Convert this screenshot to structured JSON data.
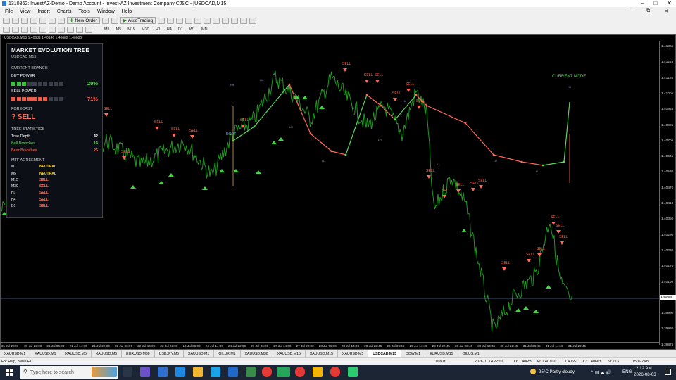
{
  "window": {
    "title": "1310862: InvestAZ-Demo - Demo Account - Invest-AZ Investment Company CJSC - [USDCAD,M15]"
  },
  "menu": [
    "File",
    "View",
    "Insert",
    "Charts",
    "Tools",
    "Window",
    "Help"
  ],
  "toolbar": {
    "new_order": "New Order",
    "auto_trading": "AutoTrading",
    "timeframes": [
      "M1",
      "M5",
      "M15",
      "M30",
      "H1",
      "H4",
      "D1",
      "W1",
      "MN"
    ]
  },
  "chart_header": "USDCAD,M15  1.40681 1.40146 1.40682 1.40686",
  "panel": {
    "title": "MARKET EVOLUTION TREE",
    "subtitle": "USDCAD M15",
    "current_branch": "CURRENT BRANCH",
    "buy_power_label": "BUY POWER",
    "buy_power_pct": "29%",
    "buy_power_value": 0.29,
    "sell_power_label": "SELL POWER",
    "sell_power_pct": "71%",
    "sell_power_value": 0.71,
    "forecast_label": "FORECAST",
    "forecast_value": "? SELL",
    "stats_label": "TREE STATISTICS",
    "tree_depth_label": "Tree Depth",
    "tree_depth": "42",
    "bull_label": "Bull Branches",
    "bull": "14",
    "bear_label": "Bear Branches",
    "bear": "26",
    "mtf_label": "MTF AGREEMENT",
    "mtf": [
      {
        "tf": "M1",
        "v": "NEUTRAL",
        "c": "#f0d040"
      },
      {
        "tf": "M5",
        "v": "NEUTRAL",
        "c": "#f0d040"
      },
      {
        "tf": "M15",
        "v": "SELL",
        "c": "#ff6b57"
      },
      {
        "tf": "M30",
        "v": "SELL",
        "c": "#ff6b57"
      },
      {
        "tf": "H1",
        "v": "SELL",
        "c": "#ff6b57"
      },
      {
        "tf": "H4",
        "v": "SELL",
        "c": "#ff6b57"
      },
      {
        "tf": "D1",
        "v": "SELL",
        "c": "#ff6b57"
      }
    ]
  },
  "chart_labels": {
    "current_node": "CURRENT NODE",
    "root": "ROOT",
    "sell": "SELL",
    "hh": "HH",
    "hl": "HL",
    "lh": "LH",
    "ll": "LL"
  },
  "price_ticks": [
    "1.41365",
    "1.41245",
    "1.41125",
    "1.41005",
    "1.40945",
    "1.40825",
    "1.40705",
    "1.40645",
    "1.40530",
    "1.40470",
    "1.40410",
    "1.40350",
    "1.40290",
    "1.40230",
    "1.40170",
    "1.40110",
    "1.40050",
    "1.39990",
    "1.39930",
    "1.39875"
  ],
  "price_marker": "1.40686",
  "time_ticks": [
    "31 Jul 2026",
    "31 Jul 22:00",
    "21 Jul 06:00",
    "21 Jul 14:00",
    "21 Jul 22:00",
    "22 Jul 06:00",
    "23 Jul 14:00",
    "23 Jul 22:00",
    "24 Jul 06:00",
    "24 Jul 14:00",
    "24 Jul 22:00",
    "27 Jul 06:00",
    "27 Jul 14:00",
    "27 Jul 22:00",
    "28 Jul 06:00",
    "28 Jul 14:00",
    "28 Jul 22:45",
    "29 Jul 06:45",
    "29 Jul 14:45",
    "29 Jul 22:45",
    "30 Jul 06:45",
    "30 Jul 14:45",
    "30 Jul 22:45",
    "31 Jul 06:45",
    "31 Jul 14:45",
    "31 Jul 22:45"
  ],
  "tabs": [
    "XAUUSD,M1",
    "XAUUSD,M1",
    "XAUUSD,M5",
    "XAUUSD,M5",
    "EURUSD,M30",
    "USDJPY,M5",
    "XAUUSD,M1",
    "OILUK,M1",
    "XAUUSD,M30",
    "XAUUSD,M15",
    "XAUUSD,M15",
    "XAUUSD,M5",
    "USDCAD,M15",
    "DOW,M1",
    "EURUSD,M15",
    "OILUS,M1"
  ],
  "active_tab_index": 12,
  "status": {
    "help": "For Help, press F1",
    "profile": "Default",
    "datetime": "2026.07.14 22:00",
    "o": "O: 1.40659",
    "h": "H: 1.40700",
    "l": "L: 1.40651",
    "c": "C: 1.40663",
    "v": "V: 773",
    "kb": "1506/2 kb"
  },
  "taskbar": {
    "search": "Type here to search",
    "weather": "25°C  Partly cloudy",
    "lang": "ENG",
    "time": "2:12 AM",
    "date": "2026-08-03"
  }
}
